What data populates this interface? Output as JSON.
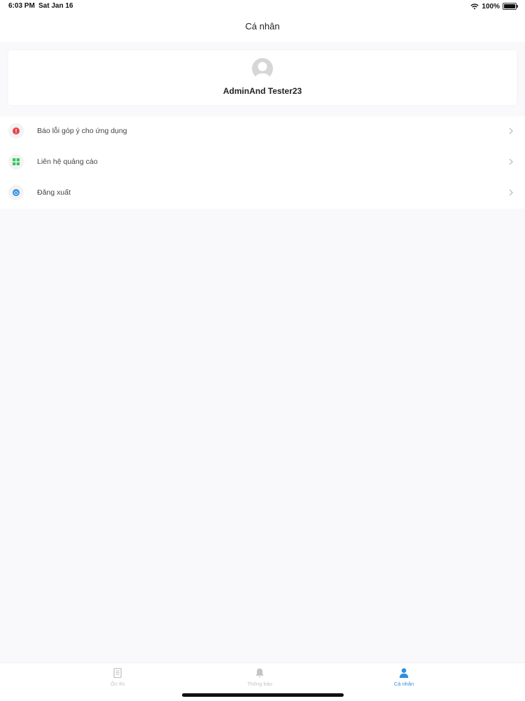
{
  "status_bar": {
    "time": "6:03 PM",
    "date": "Sat Jan 16",
    "battery": "100%"
  },
  "nav": {
    "title": "Cá nhân"
  },
  "profile": {
    "name": "AdminAnd Tester23"
  },
  "menu": {
    "items": [
      {
        "label": "Báo lỗi góp ý cho ứng dụng",
        "icon": "error-report-icon",
        "color": "#e8434b"
      },
      {
        "label": "Liên hệ quảng cáo",
        "icon": "ads-grid-icon",
        "color": "#34c759"
      },
      {
        "label": "Đăng xuất",
        "icon": "power-icon",
        "color": "#2e8fe0"
      }
    ]
  },
  "tabs": [
    {
      "label": "Ôn thi",
      "icon": "book-icon",
      "active": false
    },
    {
      "label": "Thông báo",
      "icon": "bell-icon",
      "active": false
    },
    {
      "label": "Cá nhân",
      "icon": "person-icon",
      "active": true
    }
  ],
  "colors": {
    "accent": "#2e8fe0",
    "background": "#f9f8fb"
  }
}
